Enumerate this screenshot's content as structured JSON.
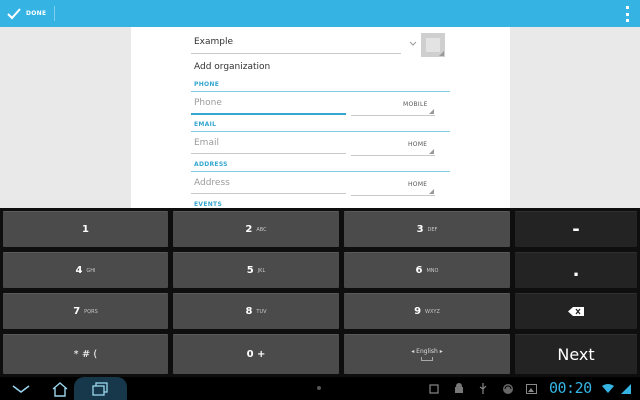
{
  "actionbar": {
    "done_label": "DONE",
    "bg": "#35b4e4"
  },
  "form": {
    "name_value": "Example",
    "add_org_label": "Add organization",
    "phone": {
      "section": "PHONE",
      "placeholder": "Phone",
      "type": "MOBILE"
    },
    "email": {
      "section": "EMAIL",
      "placeholder": "Email",
      "type": "HOME"
    },
    "address": {
      "section": "ADDRESS",
      "placeholder": "Address",
      "type": "HOME"
    },
    "events_section": "EVENTS"
  },
  "keyboard": {
    "keys": [
      {
        "main": "1",
        "sub": ""
      },
      {
        "main": "2",
        "sub": "ABC"
      },
      {
        "main": "3",
        "sub": "DEF"
      },
      {
        "main": "4",
        "sub": "GHI"
      },
      {
        "main": "5",
        "sub": "JKL"
      },
      {
        "main": "6",
        "sub": "MNO"
      },
      {
        "main": "7",
        "sub": "PQRS"
      },
      {
        "main": "8",
        "sub": "TUV"
      },
      {
        "main": "9",
        "sub": "WXYZ"
      },
      {
        "main": "* # (",
        "sub": ""
      },
      {
        "main": "0 +",
        "sub": ""
      }
    ],
    "lang": "English",
    "dash": "-",
    "period": ".",
    "next": "Next"
  },
  "status": {
    "time": "00:20"
  },
  "icons": {
    "done": "check-icon",
    "overflow": "overflow-menu-icon",
    "spinner": "chevron-down-icon",
    "photo": "contact-photo-icon",
    "backspace": "backspace-icon",
    "back": "back-icon",
    "home": "home-icon",
    "recents": "recent-apps-icon"
  }
}
